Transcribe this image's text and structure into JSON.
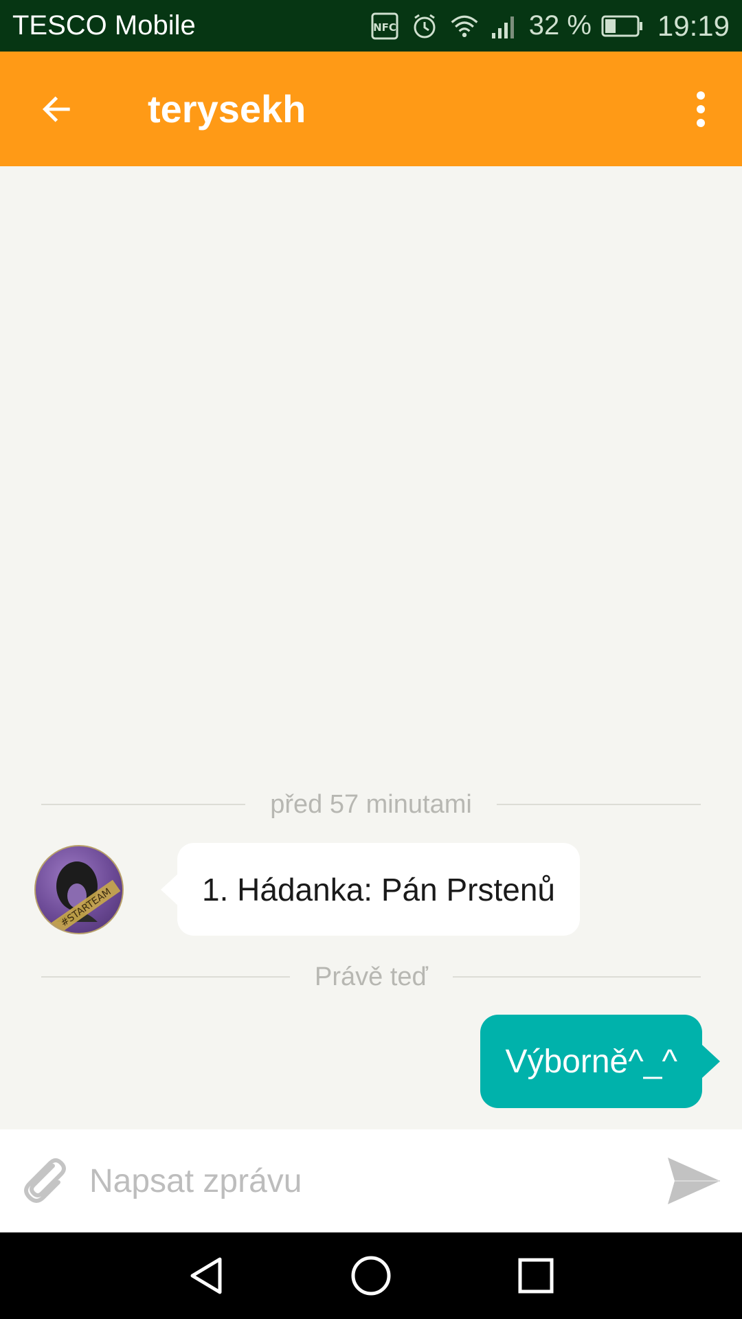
{
  "status_bar": {
    "carrier": "TESCO Mobile",
    "nfc_label": "NFC",
    "battery_percent": "32 %",
    "time": "19:19",
    "icons": [
      "nfc-icon",
      "alarm-icon",
      "wifi-icon",
      "signal-icon",
      "battery-icon"
    ]
  },
  "app_bar": {
    "title": "terysekh",
    "back_icon": "arrow-back-icon",
    "menu_icon": "more-vert-icon"
  },
  "chat": {
    "messages": [
      {
        "divider": "před 57 minutami",
        "direction": "incoming",
        "text": "1. Hádanka: Pán Prstenů",
        "avatar_text": "#STARTEAM"
      },
      {
        "divider": "Právě teď",
        "direction": "outgoing",
        "text": "Výborně^_^"
      }
    ]
  },
  "composer": {
    "placeholder": "Napsat zprávu",
    "attach_icon": "paperclip-icon",
    "send_icon": "send-icon"
  },
  "nav_bar": {
    "icons": [
      "nav-back-icon",
      "nav-home-icon",
      "nav-recents-icon"
    ]
  },
  "colors": {
    "status_bar": "#063613",
    "app_bar": "#ff9a16",
    "outgoing_bubble": "#00b2ab",
    "incoming_bubble": "#ffffff",
    "chat_background": "#f5f5f1"
  }
}
